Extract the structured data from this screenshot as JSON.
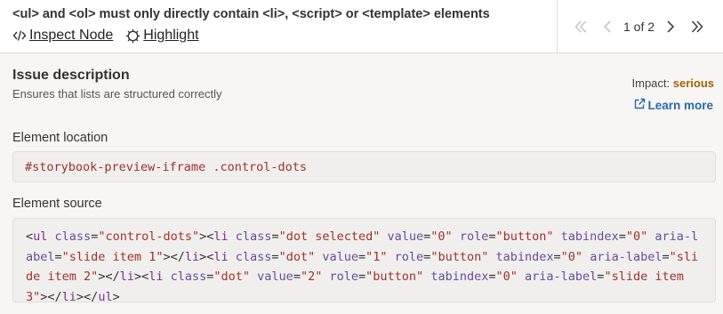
{
  "issue": {
    "title": "<ul> and <ol> must only directly contain <li>, <script> or <template> elements",
    "inspect_label": "Inspect Node",
    "highlight_label": "Highlight",
    "pager_text": "1 of 2"
  },
  "details": {
    "description_title": "Issue description",
    "description": "Ensures that lists are structured correctly",
    "impact_label": "Impact:",
    "impact_value": "serious",
    "learn_more": "Learn more",
    "location_label": "Element location",
    "location_value": "#storybook-preview-iframe .control-dots",
    "source_label": "Element source",
    "source_value": "<ul class=\"control-dots\"><li class=\"dot selected\" value=\"0\" role=\"button\" tabindex=\"0\" aria-label=\"slide item 1\"></li><li class=\"dot\" value=\"1\" role=\"button\" tabindex=\"0\" aria-label=\"slide item 2\"></li><li class=\"dot\" value=\"2\" role=\"button\" tabindex=\"0\" aria-label=\"slide item 3\"></li></ul>"
  },
  "icons": [
    "code-icon",
    "highlight-icon",
    "first-page-icon",
    "prev-icon",
    "next-icon",
    "last-page-icon",
    "external-link-icon"
  ],
  "colors": {
    "impact": "#a16400",
    "link": "#2a6aa6",
    "code_string": "#a0312a",
    "code_tag": "#7c2d8c"
  }
}
